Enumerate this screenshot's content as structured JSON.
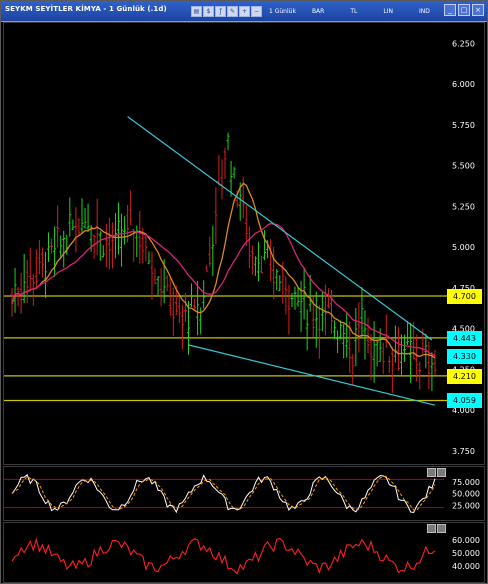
{
  "window": {
    "title": "SEYKM SEYİTLER KİMYA - 1 Günlük (.1d)",
    "toolbar": {
      "period_label": "1 Günlük",
      "chart_type_label": "BAR",
      "currency_label": "TL",
      "scale_label": "LIN",
      "indicator_label": "IND"
    },
    "controls": [
      "minimize",
      "maximize",
      "close"
    ]
  },
  "colors": {
    "background": "#000000",
    "bull_bar": "#1fd41f",
    "bear_bar": "#d41f1f",
    "trend_line": "#35c6d6",
    "horizontal_level": "#c9c400",
    "ma_fast": "#d98a1e",
    "ma_slow": "#d6247a",
    "price_tag_yellow": "#ffff00",
    "price_tag_cyan": "#00ffff",
    "stoch_k": "#ffffff",
    "stoch_d": "#ff9900",
    "rsi_line": "#ff2020",
    "panel_bg": "#000000"
  },
  "price_axis": {
    "ticks": [
      "6.250",
      "6.000",
      "5.750",
      "5.500",
      "5.250",
      "5.000",
      "4.750",
      "4.500",
      "4.250",
      "4.000",
      "3.750"
    ],
    "tick_values": [
      6.25,
      6.0,
      5.75,
      5.5,
      5.25,
      5.0,
      4.75,
      4.5,
      4.25,
      4.0,
      3.75
    ],
    "range": [
      3.7,
      6.35
    ]
  },
  "horizontal_levels": [
    {
      "value": 4.7,
      "label": "4.700",
      "tag_color": "yellow"
    },
    {
      "value": 4.443,
      "label": "4.443",
      "tag_color": "cyan"
    },
    {
      "value": 4.21,
      "label": "4.210",
      "tag_color": "yellow"
    },
    {
      "value": 4.059,
      "label": "4.059",
      "tag_color": "cyan"
    }
  ],
  "last_price": {
    "value": 4.33,
    "label": "4.330"
  },
  "stochastic": {
    "axis_ticks": [
      "75.000",
      "50.000",
      "25.000"
    ],
    "tick_values": [
      75,
      50,
      25
    ],
    "range": [
      0,
      100
    ],
    "levels": [
      80,
      20
    ]
  },
  "rsi": {
    "axis_ticks": [
      "60.000",
      "50.000",
      "40.000"
    ],
    "tick_values": [
      60,
      50,
      40
    ],
    "range": [
      30,
      70
    ]
  }
}
